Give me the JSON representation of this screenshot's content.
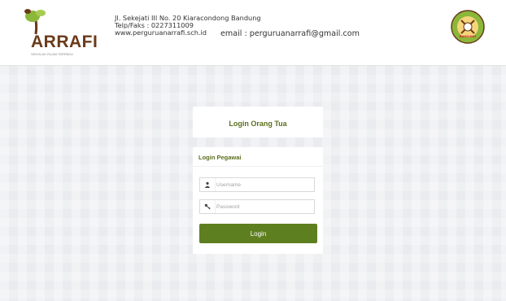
{
  "header": {
    "logo": {
      "text_main": "ARRAFI",
      "tagline": "SEKOLAH ISLAM TERPADU"
    },
    "address_lines": [
      "Jl. Sekejati III No. 20 Kiaracondong Bandung",
      "Telp/Faks : 0227311009",
      "www.perguruanarrafi.sch.id"
    ],
    "email": "email : perguruanarrafi@gmail.com",
    "seal": {
      "text": "BANDUNG"
    }
  },
  "login_orang_tua": {
    "title": "Login Orang Tua"
  },
  "login_pegawai": {
    "title": "Login Pegawai",
    "username_placeholder": "Username",
    "password_placeholder": "Password",
    "login_button": "Login"
  },
  "colors": {
    "brand_green": "#5e7f1f",
    "brand_brown": "#6b3a1a",
    "accent_lime": "#8bb83a"
  }
}
